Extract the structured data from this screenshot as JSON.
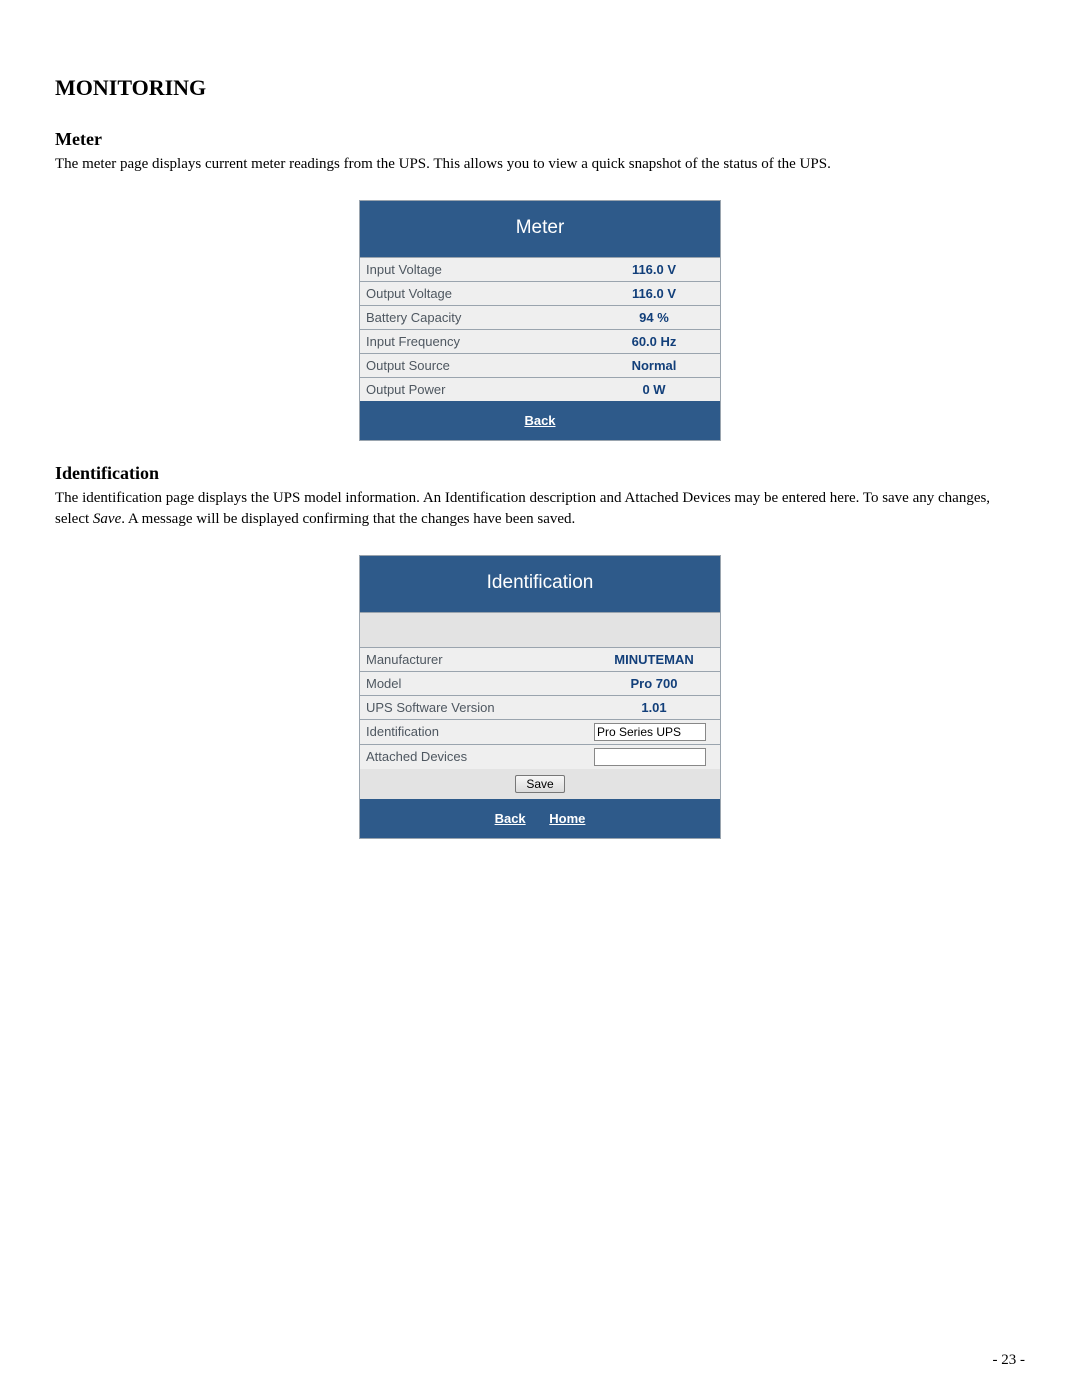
{
  "section_title": "MONITORING",
  "meter": {
    "heading": "Meter",
    "description": "The meter page displays current meter readings from the UPS.  This allows you to view a quick snapshot of the status of the UPS.",
    "panel_title": "Meter",
    "rows": [
      {
        "label": "Input Voltage",
        "value": "116.0 V"
      },
      {
        "label": "Output Voltage",
        "value": "116.0 V"
      },
      {
        "label": "Battery Capacity",
        "value": "94 %"
      },
      {
        "label": "Input Frequency",
        "value": "60.0 Hz"
      },
      {
        "label": "Output Source",
        "value": "Normal"
      },
      {
        "label": "Output Power",
        "value": "0 W"
      }
    ],
    "footer_back": "Back"
  },
  "identification": {
    "heading": "Identification",
    "description_a": "The identification page displays the UPS model information.  An Identification description and Attached Devices may be entered here.  To save any changes, select ",
    "description_em": "Save",
    "description_b": ".  A message will be displayed confirming that the changes have been saved.",
    "panel_title": "Identification",
    "rows": [
      {
        "label": "Manufacturer",
        "value": "MINUTEMAN"
      },
      {
        "label": "Model",
        "value": "Pro 700"
      },
      {
        "label": "UPS Software Version",
        "value": "1.01"
      }
    ],
    "identification_row_label": "Identification",
    "identification_value": "Pro Series UPS",
    "attached_row_label": "Attached Devices",
    "attached_value": "",
    "save_label": "Save",
    "footer_back": "Back",
    "footer_home": "Home"
  },
  "page_number": "- 23 -"
}
